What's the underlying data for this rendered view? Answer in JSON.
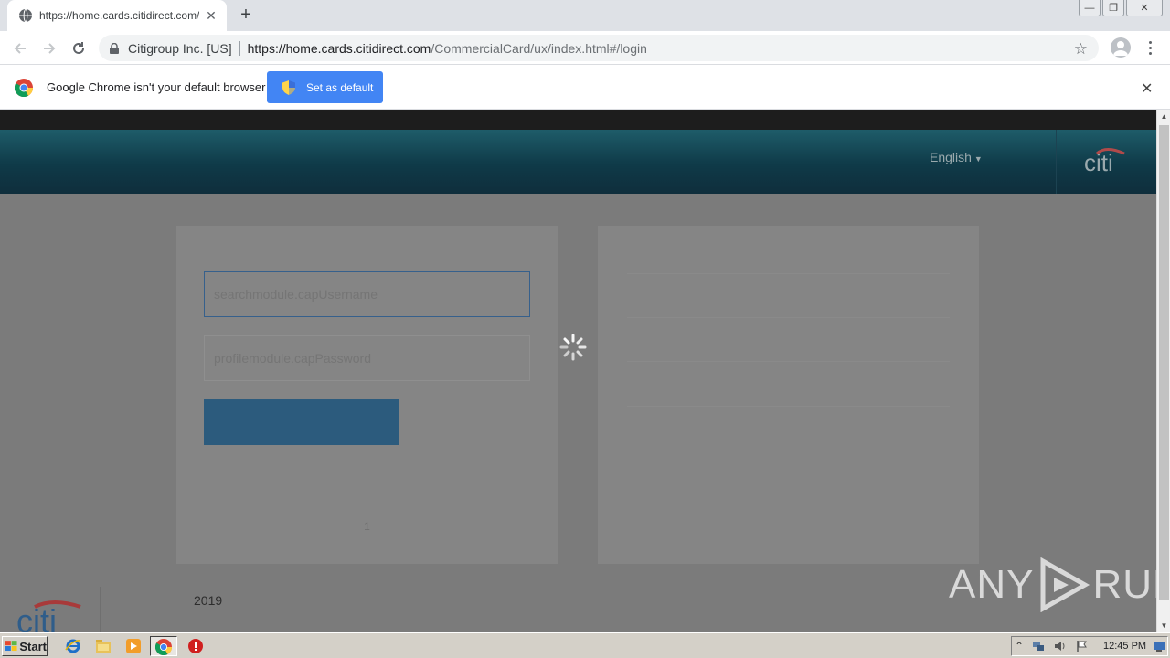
{
  "browser": {
    "tab_title": "https://home.cards.citidirect.com/Co",
    "tab_close": "✕",
    "new_tab": "+",
    "window_buttons": {
      "minimize": "—",
      "maximize": "❐",
      "close": "✕"
    },
    "site_identity": "Citigroup Inc. [US]",
    "url_host": "https://home.cards.citidirect.com",
    "url_path": "/CommercialCard/ux/index.html#/login"
  },
  "infobar": {
    "message": "Google Chrome isn't your default browser",
    "button_label": "Set as default",
    "close": "✕"
  },
  "page": {
    "language": "English",
    "username_placeholder": "searchmodule.capUsername",
    "password_placeholder": "profilemodule.capPassword",
    "pager_text": "1",
    "footer_year": "2019",
    "logo_text": "citi"
  },
  "watermark": {
    "left": "ANY",
    "right": "RUN"
  },
  "taskbar": {
    "start_label": "Start",
    "clock": "12:45 PM"
  },
  "colors": {
    "banner": "#1e5c69",
    "overlay_bg": "#7b7b7b",
    "button_blue": "#4285f4",
    "login_button": "#2c5b7d"
  }
}
